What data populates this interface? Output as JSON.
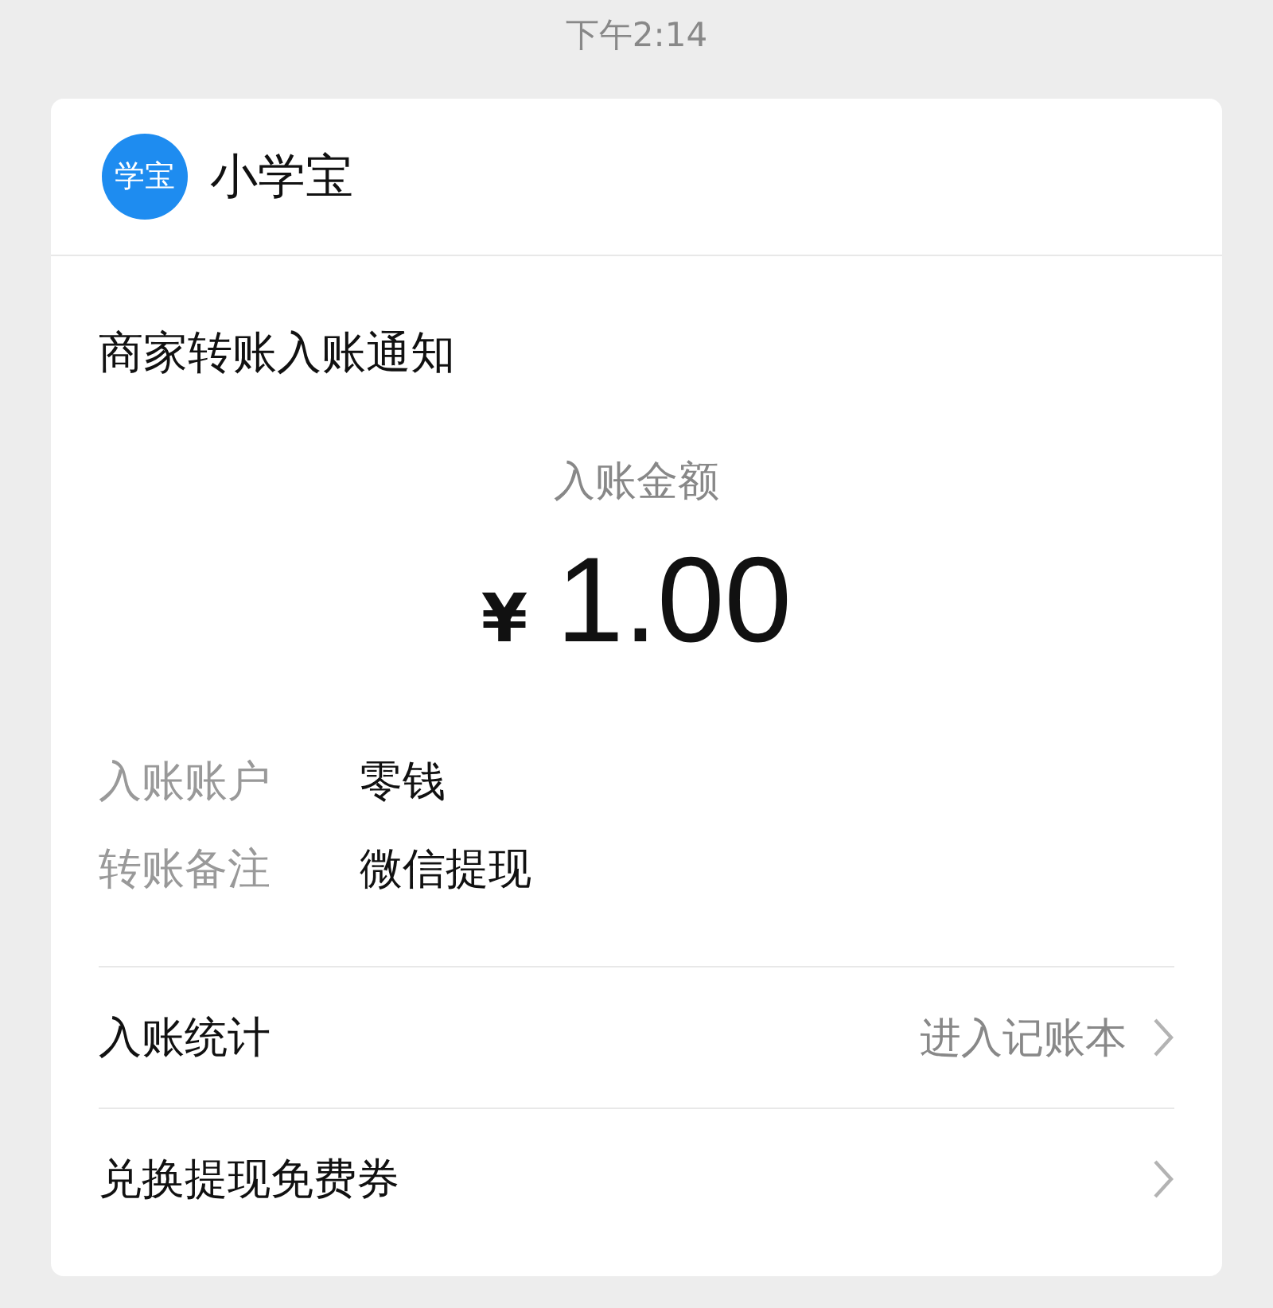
{
  "status_time": "下午2:14",
  "app": {
    "logo_text": "学宝",
    "name": "小学宝"
  },
  "notice": {
    "title": "商家转账入账通知",
    "amount_label": "入账金额",
    "currency": "¥",
    "amount": "1.00",
    "details": [
      {
        "label": "入账账户",
        "value": "零钱"
      },
      {
        "label": "转账备注",
        "value": "微信提现"
      }
    ],
    "links": [
      {
        "label": "入账统计",
        "action": "进入记账本"
      },
      {
        "label": "兑换提现免费券"
      }
    ]
  }
}
